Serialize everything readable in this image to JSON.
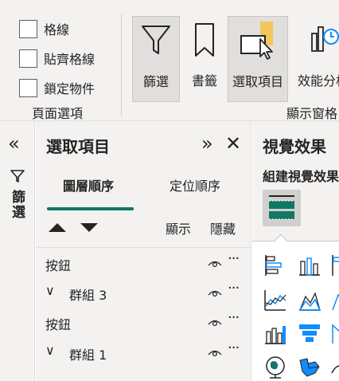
{
  "ribbon": {
    "checkboxes": [
      {
        "label": "格線",
        "checked": false
      },
      {
        "label": "貼齊格線",
        "checked": false
      },
      {
        "label": "鎖定物件",
        "checked": false
      }
    ],
    "page_options_label": "頁面選項",
    "buttons": {
      "filters": "篩選",
      "bookmarks": "書籤",
      "selection": "選取項目",
      "performance": "效能分析"
    },
    "show_panes_label": "顯示窗格"
  },
  "filters_pane": {
    "collapse_glyph": "«",
    "label": "篩選"
  },
  "selection_pane": {
    "title": "選取項目",
    "expand_glyph": "»",
    "close_glyph": "✕",
    "tabs": {
      "layer_order": "圖層順序",
      "tab_order": "定位順序"
    },
    "show_label": "顯示",
    "hide_label": "隱藏",
    "items": [
      {
        "label": "按鈕",
        "group": false
      },
      {
        "label": "群組 3",
        "group": true
      },
      {
        "label": "按鈕",
        "group": false
      },
      {
        "label": "群組 1",
        "group": true
      }
    ],
    "more_glyph": "···",
    "caret_glyph": "∨"
  },
  "viz_pane": {
    "title": "視覺效果",
    "build_label": "組建視覺效果"
  },
  "colors": {
    "accent_teal": "#117865",
    "visual_blue": "#118dff",
    "ribbon_bg": "#f3f2f1",
    "bookmark_highlight": "#f2c75c"
  }
}
